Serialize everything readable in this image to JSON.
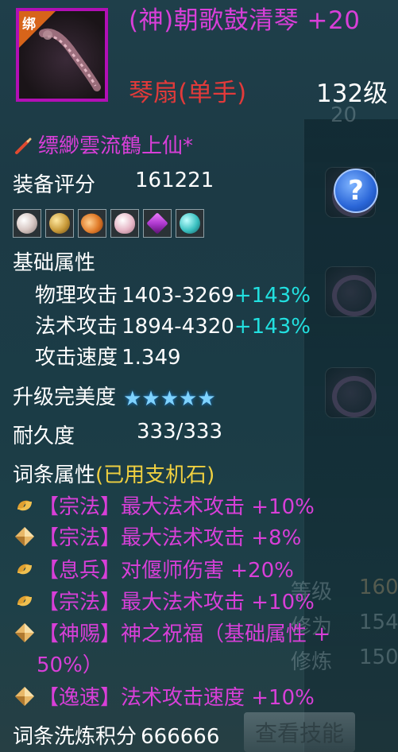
{
  "item": {
    "title": "(神)朝歌鼓清琴 +20",
    "type": "琴扇(单手)",
    "level": "132级",
    "bound_label": "绑",
    "border_color": "#b20fb5"
  },
  "maker": "缥緲雲流鶴上仙*",
  "score": {
    "label": "装备评分",
    "value": "161221"
  },
  "gems": [
    {
      "name": "pearl-gem-icon",
      "color": "#d8c8c4"
    },
    {
      "name": "gold-orb-gem-icon",
      "color": "#c89a3a"
    },
    {
      "name": "amber-gem-icon",
      "color": "#e07a28"
    },
    {
      "name": "pink-pearl-gem-icon",
      "color": "#e6b6c6"
    },
    {
      "name": "purple-crystal-gem-icon",
      "color": "#b03ad0"
    },
    {
      "name": "teal-orb-gem-icon",
      "color": "#3ac0c0"
    }
  ],
  "base": {
    "header": "基础属性",
    "stats": [
      {
        "label": "物理攻击",
        "value": "1403-3269",
        "bonus": "+143%"
      },
      {
        "label": "法术攻击",
        "value": "1894-4320",
        "bonus": "+143%"
      },
      {
        "label": "攻击速度",
        "value": "1.349",
        "bonus": ""
      }
    ]
  },
  "perfection": {
    "label": "升级完美度",
    "stars": 5
  },
  "durability": {
    "label": "耐久度",
    "value": "333/333"
  },
  "affix_header": {
    "label": "词条属性",
    "note": "(已用支机石)"
  },
  "affixes": [
    {
      "icon": "swirl-icon",
      "text": "【宗法】最大法术攻击 +10%"
    },
    {
      "icon": "diamond-icon",
      "text": "【宗法】最大法术攻击 +8%"
    },
    {
      "icon": "swirl-icon",
      "text": "【息兵】对偃师伤害 +20%"
    },
    {
      "icon": "swirl-icon",
      "text": "【宗法】最大法术攻击 +10%"
    },
    {
      "icon": "diamond-icon",
      "text": "【神赐】神之祝福（基础属性 +",
      "text2": "50%）"
    },
    {
      "icon": "diamond-icon",
      "text": "【逸速】法术攻击速度 +10%"
    }
  ],
  "refine": {
    "label": "词条洗炼积分",
    "value": "666666"
  },
  "background": {
    "ghost_level": "20",
    "rows": [
      {
        "label": "等级",
        "value": "160"
      },
      {
        "label": "修为",
        "value": "154"
      },
      {
        "label": "修炼",
        "value": "150"
      }
    ],
    "view_skill": "查看技能"
  }
}
